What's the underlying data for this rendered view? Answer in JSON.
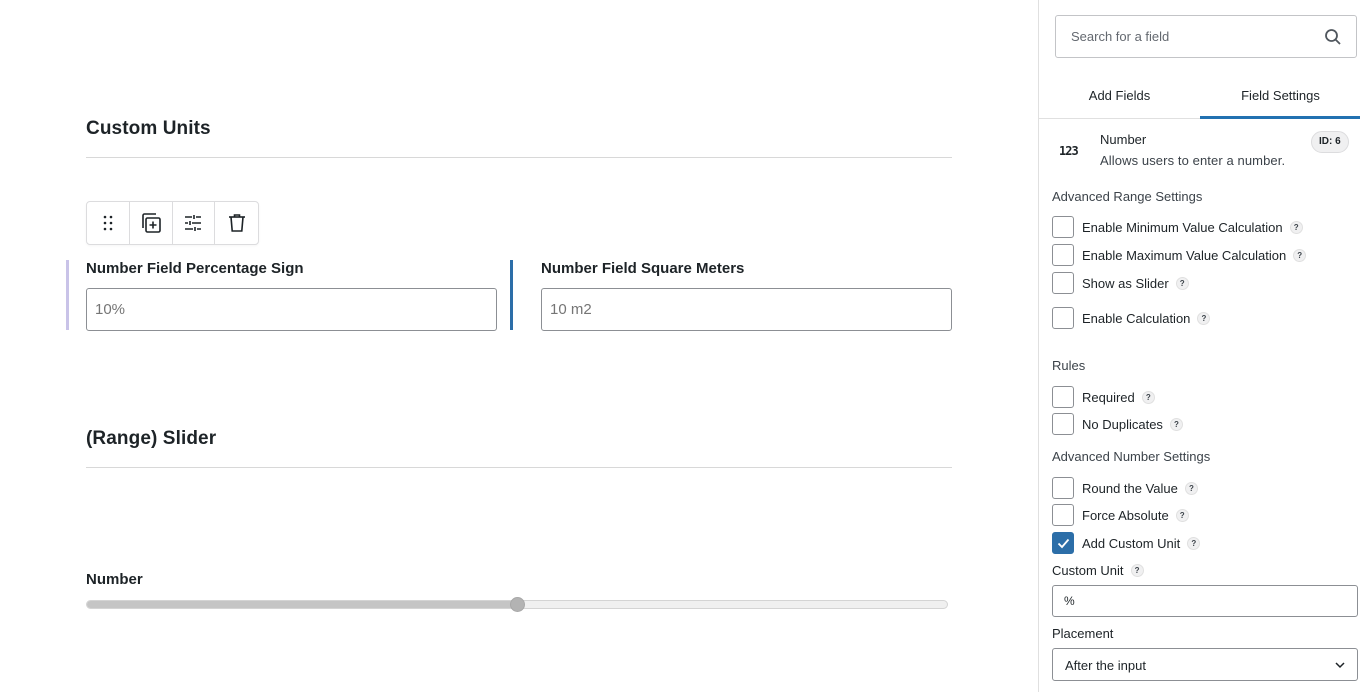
{
  "canvas": {
    "section_custom_units": "Custom Units",
    "toolbar": {
      "drag_icon": "drag-handle-icon",
      "duplicate_icon": "duplicate-icon",
      "settings_icon": "settings-sliders-icon",
      "delete_icon": "trash-icon"
    },
    "fields": [
      {
        "label": "Number Field Percentage Sign",
        "placeholder": "10%",
        "accent_color": "#c9c3e8"
      },
      {
        "label": "Number Field Square Meters",
        "placeholder": "10 m2",
        "accent_color": "#2c6ea8"
      }
    ],
    "section_range_slider": "(Range) Slider",
    "slider": {
      "label": "Number",
      "value_fraction": 0.5
    }
  },
  "sidebar": {
    "search": {
      "placeholder": "Search for a field",
      "icon": "search-icon"
    },
    "tabs": [
      {
        "label": "Add Fields",
        "active": false
      },
      {
        "label": "Field Settings",
        "active": true
      }
    ],
    "field_info": {
      "icon": "123",
      "title": "Number",
      "description": "Allows users to enter a number.",
      "id_badge": "ID: 6"
    },
    "help_glyph": "?",
    "advanced_range": {
      "title": "Advanced Range Settings",
      "options": [
        {
          "label": "Enable Minimum Value Calculation",
          "checked": false
        },
        {
          "label": "Enable Maximum Value Calculation",
          "checked": false
        },
        {
          "label": "Show as Slider",
          "checked": false
        },
        {
          "label": "Enable Calculation",
          "checked": false
        }
      ]
    },
    "rules": {
      "title": "Rules",
      "options": [
        {
          "label": "Required",
          "checked": false
        },
        {
          "label": "No Duplicates",
          "checked": false
        }
      ]
    },
    "advanced_number": {
      "title": "Advanced Number Settings",
      "options": [
        {
          "label": "Round the Value",
          "checked": false
        },
        {
          "label": "Force Absolute",
          "checked": false
        },
        {
          "label": "Add Custom Unit",
          "checked": true
        }
      ]
    },
    "custom_unit": {
      "label": "Custom Unit",
      "value": "%"
    },
    "placement": {
      "label": "Placement",
      "selected": "After the input"
    }
  },
  "colors": {
    "accent": "#2271b1",
    "checked": "#2c6ea8"
  }
}
